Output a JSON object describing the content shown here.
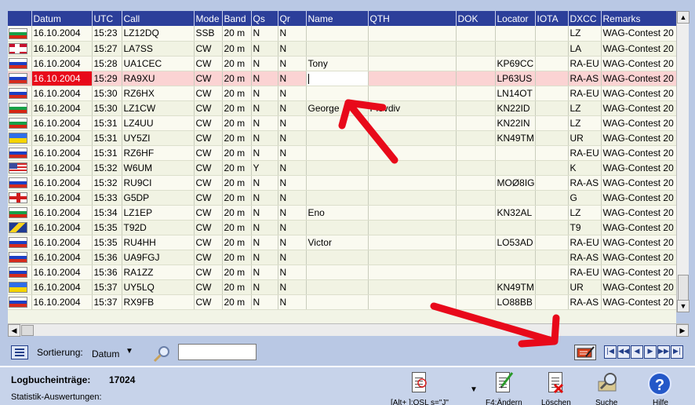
{
  "columns": [
    "",
    "Datum",
    "UTC",
    "Call",
    "Mode",
    "Band",
    "Qs",
    "Qr",
    "Name",
    "QTH",
    "DOK",
    "Locator",
    "IOTA",
    "DXCC",
    "Remarks"
  ],
  "rows": [
    {
      "flag": "bulgaria",
      "datum": "16.10.2004",
      "utc": "15:23",
      "call": "LZ12DQ",
      "mode": "SSB",
      "band": "20 m",
      "qs": "N",
      "qr": "N",
      "name": "",
      "qth": "",
      "dok": "",
      "locator": "",
      "iota": "",
      "dxcc": "LZ",
      "remarks": "WAG-Contest 20"
    },
    {
      "flag": "norway",
      "datum": "16.10.2004",
      "utc": "15:27",
      "call": "LA7SS",
      "mode": "CW",
      "band": "20 m",
      "qs": "N",
      "qr": "N",
      "name": "",
      "qth": "",
      "dok": "",
      "locator": "",
      "iota": "",
      "dxcc": "LA",
      "remarks": "WAG-Contest 20"
    },
    {
      "flag": "russia",
      "datum": "16.10.2004",
      "utc": "15:28",
      "call": "UA1CEC",
      "mode": "CW",
      "band": "20 m",
      "qs": "N",
      "qr": "N",
      "name": "Tony",
      "qth": "",
      "dok": "",
      "locator": "KP69CC",
      "iota": "",
      "dxcc": "RA-EU",
      "remarks": "WAG-Contest 20"
    },
    {
      "flag": "russia",
      "datum": "16.10.2004",
      "utc": "15:29",
      "call": "RA9XU",
      "mode": "CW",
      "band": "20 m",
      "qs": "N",
      "qr": "N",
      "name": "",
      "qth": "",
      "dok": "",
      "locator": "LP63US",
      "iota": "",
      "dxcc": "RA-AS",
      "remarks": "WAG-Contest 20",
      "selected": true
    },
    {
      "flag": "russia",
      "datum": "16.10.2004",
      "utc": "15:30",
      "call": "RZ6HX",
      "mode": "CW",
      "band": "20 m",
      "qs": "N",
      "qr": "N",
      "name": "",
      "qth": "",
      "dok": "",
      "locator": "LN14OT",
      "iota": "",
      "dxcc": "RA-EU",
      "remarks": "WAG-Contest 20"
    },
    {
      "flag": "bulgaria",
      "datum": "16.10.2004",
      "utc": "15:30",
      "call": "LZ1CW",
      "mode": "CW",
      "band": "20 m",
      "qs": "N",
      "qr": "N",
      "name": "George",
      "qth": "Plovdiv",
      "dok": "",
      "locator": "KN22ID",
      "iota": "",
      "dxcc": "LZ",
      "remarks": "WAG-Contest 20"
    },
    {
      "flag": "bulgaria",
      "datum": "16.10.2004",
      "utc": "15:31",
      "call": "LZ4UU",
      "mode": "CW",
      "band": "20 m",
      "qs": "N",
      "qr": "N",
      "name": "",
      "qth": "",
      "dok": "",
      "locator": "KN22IN",
      "iota": "",
      "dxcc": "LZ",
      "remarks": "WAG-Contest 20"
    },
    {
      "flag": "ukraine",
      "datum": "16.10.2004",
      "utc": "15:31",
      "call": "UY5ZI",
      "mode": "CW",
      "band": "20 m",
      "qs": "N",
      "qr": "N",
      "name": "",
      "qth": "",
      "dok": "",
      "locator": "KN49TM",
      "iota": "",
      "dxcc": "UR",
      "remarks": "WAG-Contest 20"
    },
    {
      "flag": "russia",
      "datum": "16.10.2004",
      "utc": "15:31",
      "call": "RZ6HF",
      "mode": "CW",
      "band": "20 m",
      "qs": "N",
      "qr": "N",
      "name": "",
      "qth": "",
      "dok": "",
      "locator": "",
      "iota": "",
      "dxcc": "RA-EU",
      "remarks": "WAG-Contest 20"
    },
    {
      "flag": "usa",
      "datum": "16.10.2004",
      "utc": "15:32",
      "call": "W6UM",
      "mode": "CW",
      "band": "20 m",
      "qs": "Y",
      "qr": "N",
      "name": "",
      "qth": "",
      "dok": "",
      "locator": "",
      "iota": "",
      "dxcc": "K",
      "remarks": "WAG-Contest 20"
    },
    {
      "flag": "russia",
      "datum": "16.10.2004",
      "utc": "15:32",
      "call": "RU9CI",
      "mode": "CW",
      "band": "20 m",
      "qs": "N",
      "qr": "N",
      "name": "",
      "qth": "",
      "dok": "",
      "locator": "MOØ8IG",
      "iota": "",
      "dxcc": "RA-AS",
      "remarks": "WAG-Contest 20"
    },
    {
      "flag": "england",
      "datum": "16.10.2004",
      "utc": "15:33",
      "call": "G5DP",
      "mode": "CW",
      "band": "20 m",
      "qs": "N",
      "qr": "N",
      "name": "",
      "qth": "",
      "dok": "",
      "locator": "",
      "iota": "",
      "dxcc": "G",
      "remarks": "WAG-Contest 20"
    },
    {
      "flag": "bulgaria",
      "datum": "16.10.2004",
      "utc": "15:34",
      "call": "LZ1EP",
      "mode": "CW",
      "band": "20 m",
      "qs": "N",
      "qr": "N",
      "name": "Eno",
      "qth": "",
      "dok": "",
      "locator": "KN32AL",
      "iota": "",
      "dxcc": "LZ",
      "remarks": "WAG-Contest 20"
    },
    {
      "flag": "bosnia",
      "datum": "16.10.2004",
      "utc": "15:35",
      "call": "T92D",
      "mode": "CW",
      "band": "20 m",
      "qs": "N",
      "qr": "N",
      "name": "",
      "qth": "",
      "dok": "",
      "locator": "",
      "iota": "",
      "dxcc": "T9",
      "remarks": "WAG-Contest 20"
    },
    {
      "flag": "russia",
      "datum": "16.10.2004",
      "utc": "15:35",
      "call": "RU4HH",
      "mode": "CW",
      "band": "20 m",
      "qs": "N",
      "qr": "N",
      "name": "Victor",
      "qth": "",
      "dok": "",
      "locator": "LO53AD",
      "iota": "",
      "dxcc": "RA-EU",
      "remarks": "WAG-Contest 20"
    },
    {
      "flag": "russia",
      "datum": "16.10.2004",
      "utc": "15:36",
      "call": "UA9FGJ",
      "mode": "CW",
      "band": "20 m",
      "qs": "N",
      "qr": "N",
      "name": "",
      "qth": "",
      "dok": "",
      "locator": "",
      "iota": "",
      "dxcc": "RA-AS",
      "remarks": "WAG-Contest 20"
    },
    {
      "flag": "russia",
      "datum": "16.10.2004",
      "utc": "15:36",
      "call": "RA1ZZ",
      "mode": "CW",
      "band": "20 m",
      "qs": "N",
      "qr": "N",
      "name": "",
      "qth": "",
      "dok": "",
      "locator": "",
      "iota": "",
      "dxcc": "RA-EU",
      "remarks": "WAG-Contest 20"
    },
    {
      "flag": "ukraine",
      "datum": "16.10.2004",
      "utc": "15:37",
      "call": "UY5LQ",
      "mode": "CW",
      "band": "20 m",
      "qs": "N",
      "qr": "N",
      "name": "",
      "qth": "",
      "dok": "",
      "locator": "KN49TM",
      "iota": "",
      "dxcc": "UR",
      "remarks": "WAG-Contest 20"
    },
    {
      "flag": "russia",
      "datum": "16.10.2004",
      "utc": "15:37",
      "call": "RX9FB",
      "mode": "CW",
      "band": "20 m",
      "qs": "N",
      "qr": "N",
      "name": "",
      "qth": "",
      "dok": "",
      "locator": "LO88BB",
      "iota": "",
      "dxcc": "RA-AS",
      "remarks": "WAG-Contest 20"
    }
  ],
  "toolbar": {
    "sort_label": "Sortierung:",
    "sort_value": "Datum",
    "search_value": ""
  },
  "status": {
    "entries_label": "Logbucheinträge:",
    "entries_count": "17024",
    "stats_label": "Statistik-Auswertungen:"
  },
  "tools": {
    "qsl_label": "[Alt+ ]:QSL s=\"J\"",
    "edit_label": "F4:Ändern",
    "delete_label": "Löschen",
    "search_label": "Suche",
    "help_label": "Hilfe"
  },
  "icons": {
    "sort": "sort-list-icon",
    "find": "magnifier-icon",
    "edit_record": "edit-record-icon",
    "help": "question-mark-icon"
  },
  "colors": {
    "header_bg": "#2c3f9a",
    "selected_row": "#fbd3d3",
    "selected_date": "#e8091a",
    "annotation_arrow": "#e8091a"
  }
}
